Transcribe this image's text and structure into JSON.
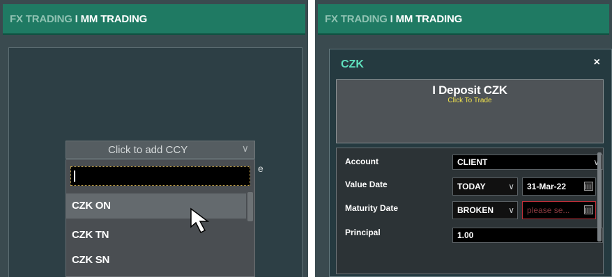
{
  "left_panel": {
    "tabs": {
      "fx": "FX TRADING",
      "separator": "I",
      "mm": "MM TRADING"
    },
    "add_ccy_label": "Click to add CCY",
    "search_value": "",
    "ccy_list": [
      "CZK ON",
      "CZK TN",
      "CZK SN"
    ],
    "stray_char": "e"
  },
  "right_panel": {
    "tabs": {
      "fx": "FX TRADING",
      "separator": "I",
      "mm": "MM TRADING"
    },
    "currency": "CZK",
    "close_glyph": "×",
    "tile": {
      "title": "I Deposit CZK",
      "subtitle": "Click To Trade"
    },
    "form": {
      "account_label": "Account",
      "account_value": "CLIENT",
      "value_date_label": "Value Date",
      "value_date_tenor": "TODAY",
      "value_date": "31-Mar-22",
      "maturity_label": "Maturity Date",
      "maturity_tenor": "BROKEN",
      "maturity_placeholder": "please se...",
      "principal_label": "Principal",
      "principal_value": "1.00"
    }
  },
  "colors": {
    "header_green": "#1f7a63",
    "ccy_title": "#5fe0bd",
    "tile_subtitle": "#f0e24d",
    "invalid_border": "#c0303a"
  },
  "icons": [
    "chevron-down-icon",
    "calendar-icon",
    "close-icon",
    "mouse-pointer-icon"
  ]
}
